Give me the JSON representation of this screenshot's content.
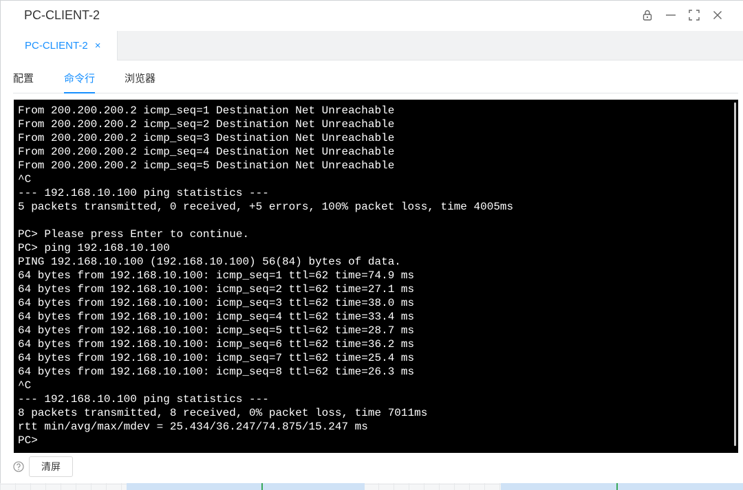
{
  "window": {
    "title": "PC-CLIENT-2"
  },
  "title_controls": [
    {
      "icon": "lock-icon"
    },
    {
      "icon": "minimize-icon"
    },
    {
      "icon": "maximize-icon"
    },
    {
      "icon": "close-icon"
    }
  ],
  "doc_tab": {
    "label": "PC-CLIENT-2",
    "close": "×"
  },
  "subtabs": [
    {
      "label": "配置",
      "active": false
    },
    {
      "label": "命令行",
      "active": true
    },
    {
      "label": "浏览器",
      "active": false
    }
  ],
  "terminal": {
    "lines": [
      "From 200.200.200.2 icmp_seq=1 Destination Net Unreachable",
      "From 200.200.200.2 icmp_seq=2 Destination Net Unreachable",
      "From 200.200.200.2 icmp_seq=3 Destination Net Unreachable",
      "From 200.200.200.2 icmp_seq=4 Destination Net Unreachable",
      "From 200.200.200.2 icmp_seq=5 Destination Net Unreachable",
      "^C",
      "--- 192.168.10.100 ping statistics ---",
      "5 packets transmitted, 0 received, +5 errors, 100% packet loss, time 4005ms",
      "",
      "PC> Please press Enter to continue.",
      "PC> ping 192.168.10.100",
      "PING 192.168.10.100 (192.168.10.100) 56(84) bytes of data.",
      "64 bytes from 192.168.10.100: icmp_seq=1 ttl=62 time=74.9 ms",
      "64 bytes from 192.168.10.100: icmp_seq=2 ttl=62 time=27.1 ms",
      "64 bytes from 192.168.10.100: icmp_seq=3 ttl=62 time=38.0 ms",
      "64 bytes from 192.168.10.100: icmp_seq=4 ttl=62 time=33.4 ms",
      "64 bytes from 192.168.10.100: icmp_seq=5 ttl=62 time=28.7 ms",
      "64 bytes from 192.168.10.100: icmp_seq=6 ttl=62 time=36.2 ms",
      "64 bytes from 192.168.10.100: icmp_seq=7 ttl=62 time=25.4 ms",
      "64 bytes from 192.168.10.100: icmp_seq=8 ttl=62 time=26.3 ms",
      "^C",
      "--- 192.168.10.100 ping statistics ---",
      "8 packets transmitted, 8 received, 0% packet loss, time 7011ms",
      "rtt min/avg/max/mdev = 25.434/36.247/74.875/15.247 ms",
      "PC>"
    ]
  },
  "footer": {
    "help_icon": "help-circle-icon",
    "clear_label": "清屏"
  },
  "colors": {
    "accent": "#1890ff",
    "terminal_bg": "#000000",
    "terminal_fg": "#ffffff"
  }
}
